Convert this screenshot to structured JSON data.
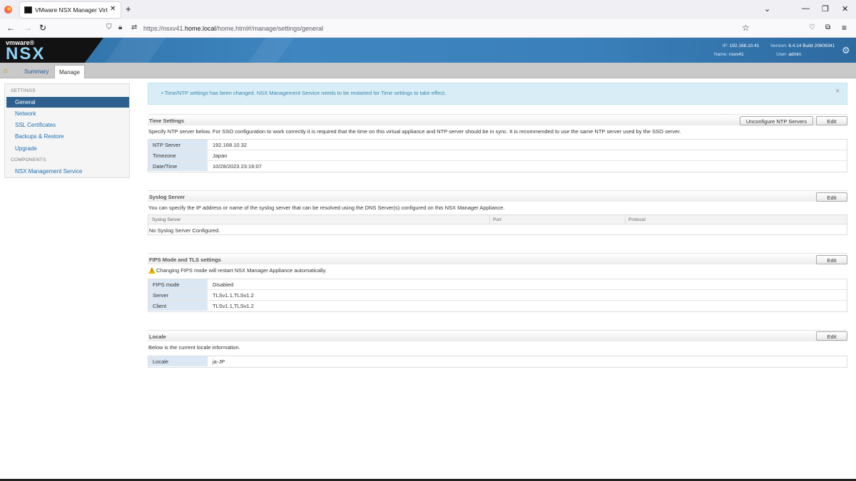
{
  "browser": {
    "tab_title": "VMware NSX Manager Virtual A",
    "tab_close": "✕",
    "new_tab": "+",
    "url_prefix": "https://nsxv41.",
    "url_domain": "home.local",
    "url_path": "/home.html#/manage/settings/general"
  },
  "banner": {
    "vmware": "vmware®",
    "product": "NSX",
    "ip_label": "IP:",
    "ip": "192.168.10.41",
    "version_label": "Version:",
    "version": "6.4.14 Build 20609341",
    "name_label": "Name:",
    "name": "nsxv41",
    "user_label": "User:",
    "user": "admin"
  },
  "app_tabs": {
    "summary": "Summary",
    "manage": "Manage"
  },
  "sidebar": {
    "settings_head": "SETTINGS",
    "items": [
      "General",
      "Network",
      "SSL Certificates",
      "Backups & Restore",
      "Upgrade"
    ],
    "components_head": "COMPONENTS",
    "component_items": [
      "NSX Management Service"
    ]
  },
  "alert": {
    "text": "• Time/NTP settings has been changed. NSX Management Service needs to be restarted for Time settings to take effect.",
    "close": "×"
  },
  "time_settings": {
    "title": "Time Settings",
    "unconfigure_label": "Unconfigure NTP Servers",
    "edit_label": "Edit",
    "description": "Specify NTP server below. For SSO configuration to work correctly it is required that the time on this virtual appliance and NTP server should be in sync. It is recommended to use the same NTP server used by the SSO server.",
    "rows": [
      {
        "key": "NTP Server",
        "value": "192.168.10.32"
      },
      {
        "key": "Timezone",
        "value": "Japan"
      },
      {
        "key": "Date/Time",
        "value": "10/28/2023 23:16:07"
      }
    ]
  },
  "syslog": {
    "title": "Syslog Server",
    "edit_label": "Edit",
    "description": "You can specify the IP address or name of the syslog server that can be resolved using the DNS Server(s) configured on this NSX Manager Appliance.",
    "columns": [
      "Syslog Server",
      "Port",
      "Protocol"
    ],
    "empty": "No Syslog Server Configured."
  },
  "fips": {
    "title": "FIPS Mode and TLS settings",
    "edit_label": "Edit",
    "warning": "Changing FIPS mode will restart NSX Manager Appliance automatically.",
    "rows": [
      {
        "key": "FIPS mode",
        "value": "Disabled"
      },
      {
        "key": "Server",
        "value": "TLSv1.1,TLSv1.2"
      },
      {
        "key": "Client",
        "value": "TLSv1.1,TLSv1.2"
      }
    ]
  },
  "locale": {
    "title": "Locale",
    "edit_label": "Edit",
    "description": "Below is the current locale information.",
    "rows": [
      {
        "key": "Locale",
        "value": "ja-JP"
      }
    ]
  },
  "colors": {
    "banner": "#3f86c0",
    "sidebar_active": "#2d5f8f",
    "link": "#1f6fb2",
    "alert_bg": "#d9edf7",
    "key_bg": "#dbe7f3"
  }
}
